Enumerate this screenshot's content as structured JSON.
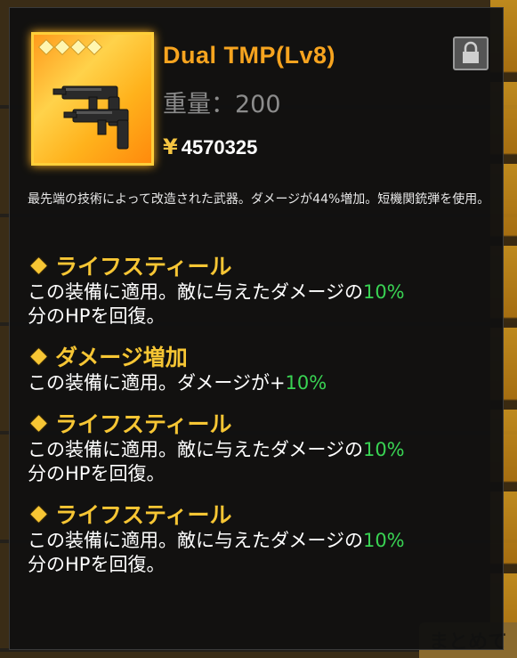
{
  "background": {
    "corner_button_label": "まとめて"
  },
  "item": {
    "name": "Dual TMP(Lv8)",
    "weight_label": "重量：200",
    "currency_symbol": "¥",
    "price": "4570325",
    "rarity_stars": 4,
    "description": "最先端の技術によって改造された武器。ダメージが44%増加。短機関銃弾を使用。",
    "icons": {
      "lock": "lock-icon",
      "weapon": "smg-icon"
    }
  },
  "skills": [
    {
      "name": "ライフスティール",
      "text_before": "この装備に適用。敵に与えたダメージの",
      "value": "10%",
      "text_after": "分のHPを回復。"
    },
    {
      "name": "ダメージ増加",
      "text_before": "この装備に適用。ダメージが+",
      "value": "10%",
      "text_after": ""
    },
    {
      "name": "ライフスティール",
      "text_before": "この装備に適用。敵に与えたダメージの",
      "value": "10%",
      "text_after": "分のHPを回復。"
    },
    {
      "name": "ライフスティール",
      "text_before": "この装備に適用。敵に与えたダメージの",
      "value": "10%",
      "text_after": "分のHPを回復。"
    }
  ],
  "colors": {
    "title": "#f7a41f",
    "skill_name": "#f7c634",
    "highlight": "#39d353",
    "frame_gold": "#ffcf3a"
  }
}
